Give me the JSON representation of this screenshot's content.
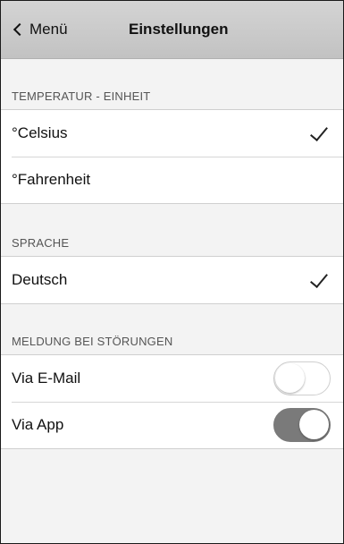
{
  "navbar": {
    "back_label": "Menü",
    "title": "Einstellungen"
  },
  "sections": {
    "temperature": {
      "header": "TEMPERATUR - EINHEIT",
      "options": [
        {
          "label": "°Celsius",
          "selected": true
        },
        {
          "label": "°Fahrenheit",
          "selected": false
        }
      ]
    },
    "language": {
      "header": "SPRACHE",
      "options": [
        {
          "label": "Deutsch",
          "selected": true
        }
      ]
    },
    "notifications": {
      "header": "MELDUNG BEI STÖRUNGEN",
      "items": [
        {
          "label": "Via E-Mail",
          "enabled": false
        },
        {
          "label": "Via App",
          "enabled": true
        }
      ]
    }
  },
  "colors": {
    "navbar": "#c8c8c8",
    "toggle_on": "#7a7a7a",
    "background": "#f3f3f3"
  }
}
